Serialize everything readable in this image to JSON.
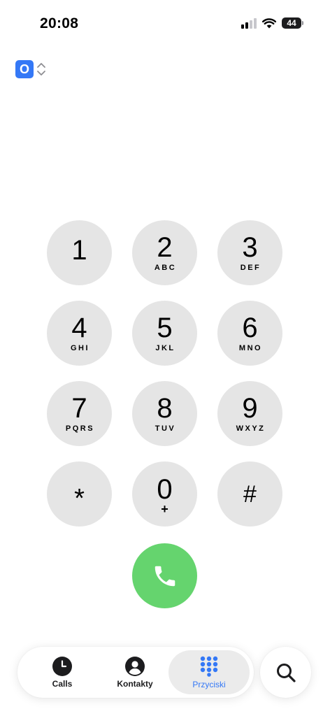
{
  "status_bar": {
    "time": "20:08",
    "battery": "44"
  },
  "sim": {
    "label": "O"
  },
  "keypad": {
    "keys": [
      {
        "digit": "1",
        "letters": ""
      },
      {
        "digit": "2",
        "letters": "ABC"
      },
      {
        "digit": "3",
        "letters": "DEF"
      },
      {
        "digit": "4",
        "letters": "GHI"
      },
      {
        "digit": "5",
        "letters": "JKL"
      },
      {
        "digit": "6",
        "letters": "MNO"
      },
      {
        "digit": "7",
        "letters": "PQRS"
      },
      {
        "digit": "8",
        "letters": "TUV"
      },
      {
        "digit": "9",
        "letters": "WXYZ"
      },
      {
        "digit": "*",
        "letters": ""
      },
      {
        "digit": "0",
        "letters": "+"
      },
      {
        "digit": "#",
        "letters": ""
      }
    ]
  },
  "tabbar": {
    "tabs": [
      {
        "label": "Calls",
        "icon": "clock-icon",
        "active": false
      },
      {
        "label": "Kontakty",
        "icon": "contact-icon",
        "active": false
      },
      {
        "label": "Przyciski",
        "icon": "keypad-icon",
        "active": true
      }
    ]
  },
  "icons": {
    "call": "phone-icon",
    "search": "search-icon"
  },
  "colors": {
    "accent": "#3478f6",
    "call_green": "#65d46e",
    "key_background": "#e5e5e5"
  }
}
